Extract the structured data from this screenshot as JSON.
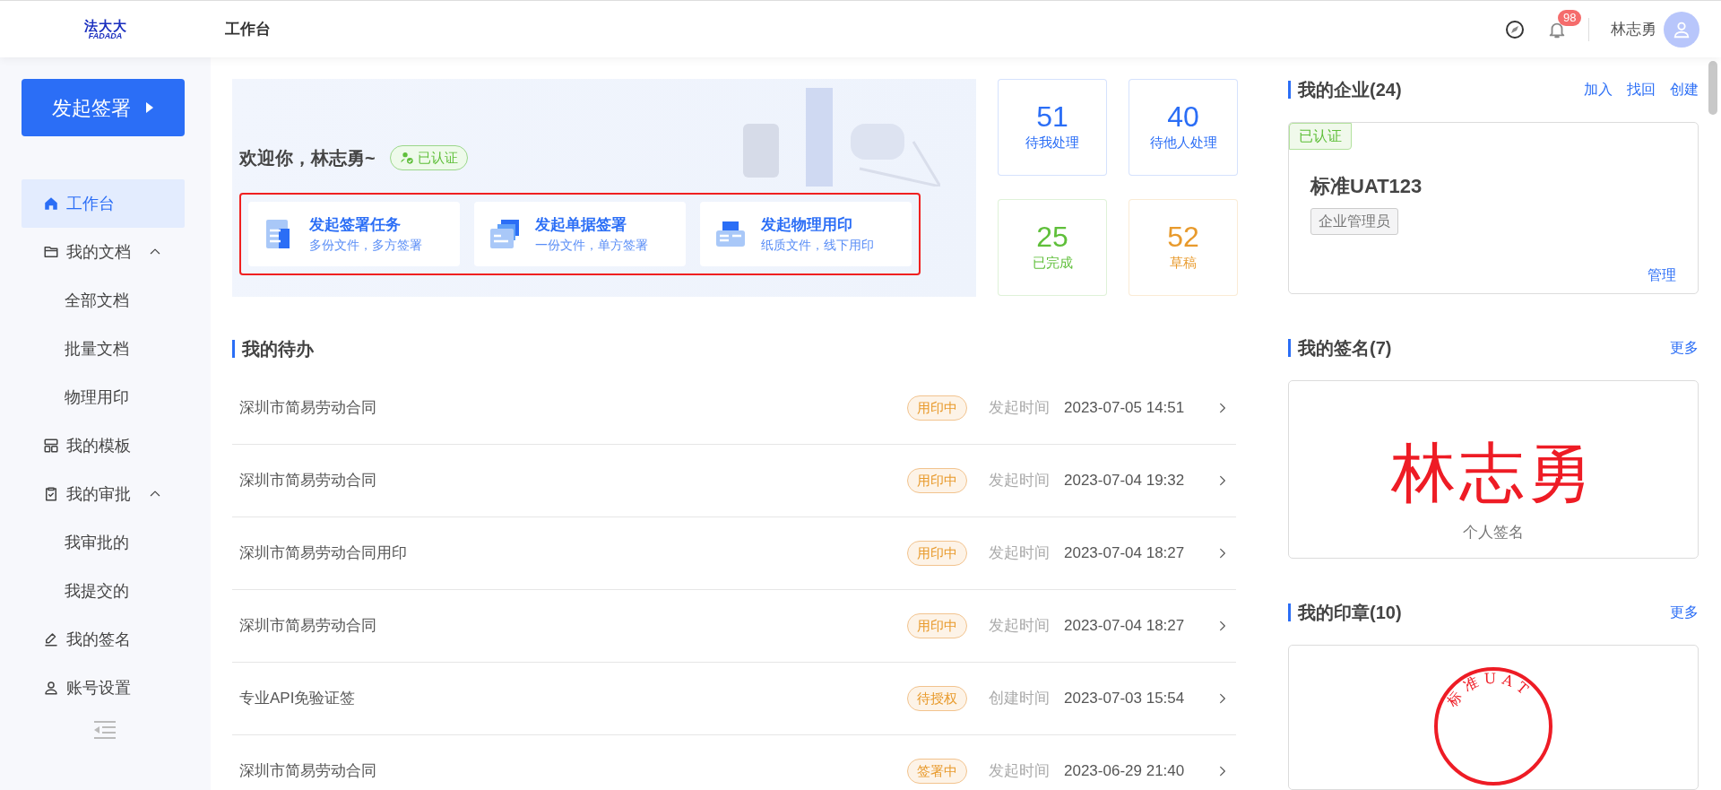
{
  "header": {
    "logo_cn": "法大大",
    "logo_en": "FADADA",
    "title": "工作台",
    "notification_count": "98",
    "user_name": "林志勇"
  },
  "sidebar": {
    "primary_button": "发起签署",
    "items": [
      {
        "label": "工作台",
        "selected": true
      },
      {
        "label": "我的文档",
        "selected": false,
        "expanded": true,
        "children": [
          {
            "label": "全部文档",
            "selected": false
          },
          {
            "label": "批量文档",
            "selected": false
          },
          {
            "label": "物理用印",
            "selected": false
          }
        ]
      },
      {
        "label": "我的模板",
        "selected": false
      },
      {
        "label": "我的审批",
        "selected": false,
        "expanded": true,
        "children": [
          {
            "label": "我审批的",
            "selected": false
          },
          {
            "label": "我提交的",
            "selected": false
          }
        ]
      },
      {
        "label": "我的签名",
        "selected": false
      },
      {
        "label": "账号设置",
        "selected": false
      }
    ]
  },
  "welcome": {
    "greeting": "欢迎你，林志勇~",
    "verified_badge": "已认证",
    "actions": [
      {
        "title": "发起签署任务",
        "subtitle": "多份文件，多方签署"
      },
      {
        "title": "发起单据签署",
        "subtitle": "一份文件，单方签署"
      },
      {
        "title": "发起物理用印",
        "subtitle": "纸质文件，线下用印"
      }
    ]
  },
  "stats": [
    {
      "value": "51",
      "label": "待我处理",
      "color": "#2b6ef6"
    },
    {
      "value": "40",
      "label": "待他人处理",
      "color": "#2b6ef6"
    },
    {
      "value": "25",
      "label": "已完成",
      "color": "#5fbf3a"
    },
    {
      "value": "52",
      "label": "草稿",
      "color": "#e89a2c"
    }
  ],
  "todo": {
    "title": "我的待办",
    "rows": [
      {
        "name": "深圳市简易劳动合同",
        "status": "用印中",
        "time_label": "发起时间",
        "time": "2023-07-05 14:51"
      },
      {
        "name": "深圳市简易劳动合同",
        "status": "用印中",
        "time_label": "发起时间",
        "time": "2023-07-04 19:32"
      },
      {
        "name": "深圳市简易劳动合同用印",
        "status": "用印中",
        "time_label": "发起时间",
        "time": "2023-07-04 18:27"
      },
      {
        "name": "深圳市简易劳动合同",
        "status": "用印中",
        "time_label": "发起时间",
        "time": "2023-07-04 18:27"
      },
      {
        "name": "专业API免验证签",
        "status": "待授权",
        "time_label": "创建时间",
        "time": "2023-07-03 15:54"
      },
      {
        "name": "深圳市简易劳动合同",
        "status": "签署中",
        "time_label": "发起时间",
        "time": "2023-06-29 21:40"
      }
    ]
  },
  "companies": {
    "title": "我的企业(24)",
    "links": [
      "加入",
      "找回",
      "创建"
    ],
    "card": {
      "tag": "已认证",
      "name": "标准UAT123",
      "role": "企业管理员",
      "manage": "管理"
    }
  },
  "signatures": {
    "title": "我的签名(7)",
    "more": "更多",
    "signature": "林志勇",
    "caption": "个人签名"
  },
  "seals": {
    "title": "我的印章(10)",
    "more": "更多",
    "seal_text": "标准UAT"
  }
}
